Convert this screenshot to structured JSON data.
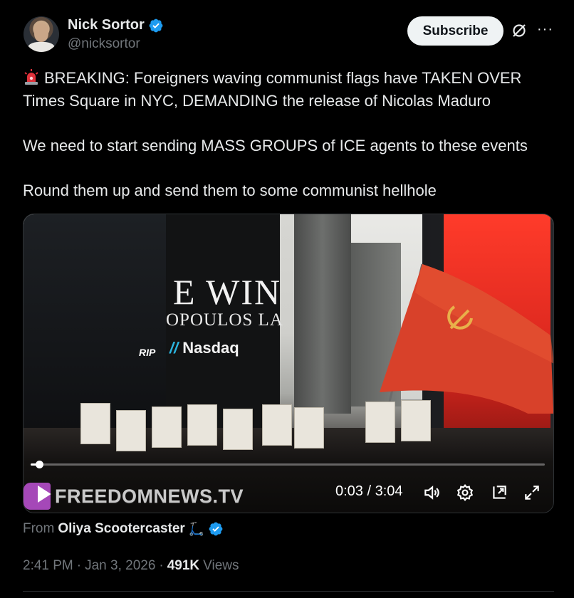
{
  "author": {
    "display_name": "Nick Sortor",
    "handle": "@nicksortor",
    "verified": true
  },
  "header": {
    "subscribe_label": "Subscribe",
    "grok_icon": "grok-slash-circle-icon",
    "more_icon": "more-dots-icon",
    "more_glyph": "···"
  },
  "tweet": {
    "lines": [
      "BREAKING: Foreigners waving communist flags have TAKEN OVER\nTimes Square in NYC, DEMANDING the release of Nicolas Maduro",
      "We need to start sending MASS GROUPS of ICE agents to these events",
      "Round them up and send them to some communist hellhole"
    ],
    "leading_emoji": "siren-light-icon"
  },
  "video": {
    "watermark": "FREEDOMNEWS.TV",
    "current_time": "0:03",
    "duration": "3:04",
    "time_display": "0:03 / 3:04",
    "progress_fraction": 0.016,
    "scene_signs": {
      "sign_main": "E WIN",
      "sign_sub": "OPOULOS LA",
      "nasdaq": "Nasdaq",
      "rip": "RIP"
    },
    "controls": [
      "play-icon",
      "volume-icon",
      "settings-gear-icon",
      "pip-icon",
      "fullscreen-icon"
    ]
  },
  "attribution": {
    "from_label": "From",
    "source_name": "Oliya Scootercaster",
    "source_emoji": "scooter-icon",
    "scooter_glyph": "🛴",
    "verified": true
  },
  "meta": {
    "time": "2:41 PM",
    "separator": "·",
    "date": "Jan 3, 2026",
    "views_count": "491K",
    "views_label": "Views"
  },
  "colors": {
    "background": "#000000",
    "verified_blue": "#1d9bf0",
    "text_primary": "#e7e9ea",
    "text_secondary": "#71767b",
    "subscribe_bg": "#eff3f4"
  }
}
